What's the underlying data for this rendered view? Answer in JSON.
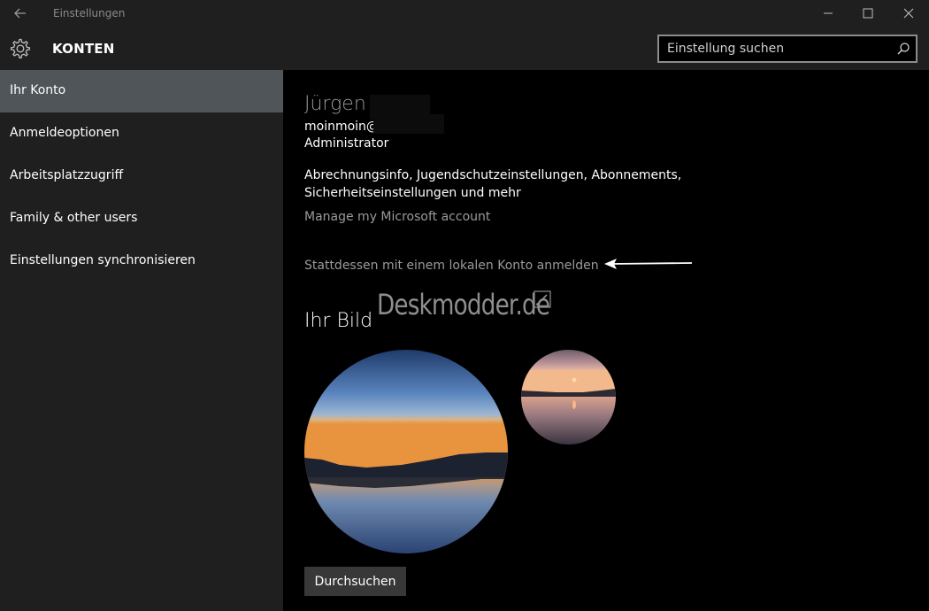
{
  "window": {
    "title": "Einstellungen"
  },
  "header": {
    "title": "KONTEN",
    "search_placeholder": "Einstellung suchen"
  },
  "sidebar": {
    "items": [
      {
        "label": "Ihr Konto",
        "selected": true
      },
      {
        "label": "Anmeldeoptionen",
        "selected": false
      },
      {
        "label": "Arbeitsplatzzugriff",
        "selected": false
      },
      {
        "label": "Family & other users",
        "selected": false
      },
      {
        "label": "Einstellungen synchronisieren",
        "selected": false
      }
    ]
  },
  "account": {
    "name": "Jürgen",
    "email": "moinmoin@",
    "role": "Administrator",
    "billing_info": "Abrechnungsinfo, Jugendschutzeinstellungen, Abonnements, Sicherheitseinstellungen und mehr",
    "manage_link": "Manage my Microsoft account",
    "local_account_link": "Stattdessen mit einem lokalen Konto anmelden"
  },
  "watermark": "Deskmodder.de",
  "picture": {
    "heading": "Ihr Bild",
    "browse_label": "Durchsuchen"
  },
  "colors": {
    "chrome": "#1f1f1f",
    "selected_nav": "#4f5558",
    "content_bg": "#000000",
    "link": "#9a9a9a",
    "button": "#383838"
  }
}
